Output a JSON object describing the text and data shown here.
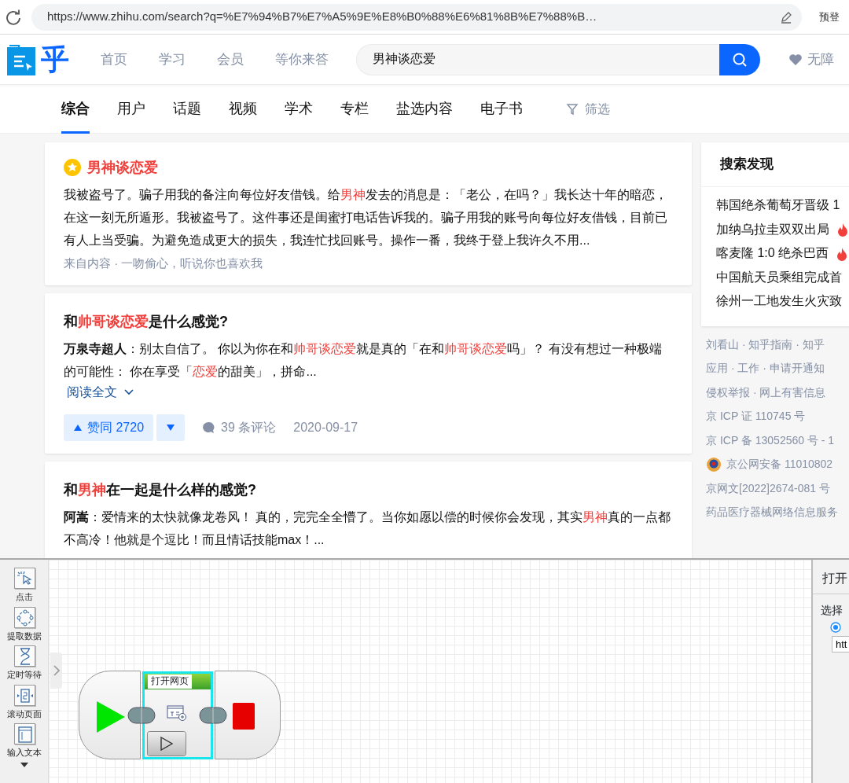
{
  "browser": {
    "url": "https://www.zhihu.com/search?q=%E7%94%B7%E7%A5%9E%E8%B0%88%E6%81%8B%E7%88%B…",
    "profile": "预登"
  },
  "header": {
    "logo_text": "乎",
    "nav": [
      {
        "label": "首页"
      },
      {
        "label": "学习"
      },
      {
        "label": "会员"
      },
      {
        "label": "等你来答"
      }
    ],
    "search": {
      "value": "男神谈恋爱"
    },
    "accessibility": "无障"
  },
  "tabs": [
    {
      "label": "综合",
      "selected": true
    },
    {
      "label": "用户",
      "selected": false
    },
    {
      "label": "话题",
      "selected": false
    },
    {
      "label": "视频",
      "selected": false
    },
    {
      "label": "学术",
      "selected": false
    },
    {
      "label": "专栏",
      "selected": false
    },
    {
      "label": "盐选内容",
      "selected": false
    },
    {
      "label": "电子书",
      "selected": false
    }
  ],
  "filter": "筛选",
  "results": [
    {
      "kind": "featured",
      "title": [
        {
          "text": "男神谈恋爱",
          "kind": "plain"
        }
      ],
      "body": [
        {
          "text": "我被盗号了。骗子用我的备注向每位好友借钱。给",
          "kind": "plain"
        },
        {
          "text": "男神",
          "kind": "highlight"
        },
        {
          "text": "发去的消息是：「老公，在吗？」我长达十年的暗恋，在这一刻无所遁形。我被盗号了。这件事还是闺蜜打电话告诉我的。骗子用我的账号向每位好友借钱，目前已有人上当受骗。为避免造成更大的损失，我连忙找回账号。操作一番，我终于登上我许久不用...",
          "kind": "plain"
        }
      ],
      "source": "来自内容 · 一吻偷心，听说你也喜欢我"
    },
    {
      "kind": "answer",
      "title": [
        {
          "text": "和",
          "kind": "plain"
        },
        {
          "text": "帅哥谈恋爱",
          "kind": "highlight"
        },
        {
          "text": "是什么感觉?",
          "kind": "plain"
        }
      ],
      "body": [
        {
          "text": "万泉寺超人",
          "kind": "author"
        },
        {
          "text": "：别太自信了。 你以为你在和",
          "kind": "plain"
        },
        {
          "text": "帅哥谈恋爱",
          "kind": "highlight"
        },
        {
          "text": "就是真的「在和",
          "kind": "plain"
        },
        {
          "text": "帅哥谈恋爱",
          "kind": "highlight"
        },
        {
          "text": "吗」？ 有没有想过一种极端的可能性： 你在享受「",
          "kind": "plain"
        },
        {
          "text": "恋爱",
          "kind": "highlight"
        },
        {
          "text": "的甜美」，拼命...",
          "kind": "plain"
        }
      ],
      "read_more": "阅读全文",
      "vote": "赞同 2720",
      "comments": "39 条评论",
      "date": "2020-09-17"
    },
    {
      "kind": "answer",
      "title": [
        {
          "text": "和",
          "kind": "plain"
        },
        {
          "text": "男神",
          "kind": "highlight"
        },
        {
          "text": "在一起是什么样的感觉?",
          "kind": "plain"
        }
      ],
      "body": [
        {
          "text": "阿嵩",
          "kind": "author"
        },
        {
          "text": "：爱情来的太快就像龙卷风！ 真的，完完全全懵了。当你如愿以偿的时候你会发现，其实",
          "kind": "plain"
        },
        {
          "text": "男神",
          "kind": "highlight"
        },
        {
          "text": "真的一点都不高冷！他就是个逗比！而且情话技能max！...",
          "kind": "plain"
        }
      ]
    }
  ],
  "sidebar": {
    "title": "搜索发现",
    "hot": [
      {
        "text": "韩国绝杀葡萄牙晋级 1",
        "hot": false
      },
      {
        "text": "加纳乌拉圭双双出局",
        "hot": true
      },
      {
        "text": "喀麦隆 1:0 绝杀巴西",
        "hot": true
      },
      {
        "text": "中国航天员乘组完成首",
        "hot": false
      },
      {
        "text": "徐州一工地发生火灾致",
        "hot": false
      }
    ],
    "footer": [
      {
        "kind": "text",
        "text": "刘看山 · 知乎指南 · 知乎"
      },
      {
        "kind": "text",
        "text": "应用 · 工作 · 申请开通知"
      },
      {
        "kind": "text",
        "text": "侵权举报 · 网上有害信息"
      },
      {
        "kind": "text",
        "text": "京 ICP 证 110745 号"
      },
      {
        "kind": "text",
        "text": "京 ICP 备 13052560 号 - 1"
      },
      {
        "kind": "police",
        "text": "京公网安备 11010802"
      },
      {
        "kind": "text",
        "text": "京网文[2022]2674-081 号"
      },
      {
        "kind": "text",
        "text": "药品医疗器械网络信息服务"
      }
    ]
  },
  "tool": {
    "tools": [
      {
        "kind": "click",
        "label": "点击"
      },
      {
        "kind": "extract",
        "label": "提取数据"
      },
      {
        "kind": "wait",
        "label": "定时等待"
      },
      {
        "kind": "scroll",
        "label": "滚动页面"
      },
      {
        "kind": "input",
        "label": "输入文本"
      }
    ],
    "flow": [
      {
        "kind": "start"
      },
      {
        "kind": "action",
        "label": "打开网页",
        "selected": true
      },
      {
        "kind": "end"
      }
    ],
    "panel": {
      "title": "打开",
      "label": "选择",
      "radio_checked": true,
      "field_value": "htt"
    }
  }
}
